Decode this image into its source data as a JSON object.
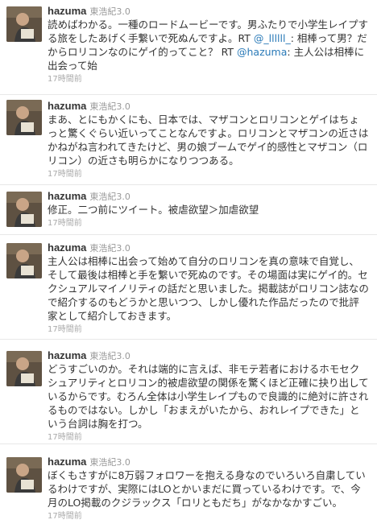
{
  "user": {
    "screen_name": "hazuma",
    "display_name": "東浩紀3.0"
  },
  "tweets": [
    {
      "parts": [
        {
          "text": "読めばわかる。一種のロードムービーです。男ふたりで小学生レイプする旅をしたあげく手繋いで死ぬんですよ。RT "
        },
        {
          "text": "@_llllll_",
          "link": true
        },
        {
          "text": ": 相棒って男？だからロリコンなのにゲイ的ってこと？ RT "
        },
        {
          "text": "@hazuma",
          "link": true
        },
        {
          "text": ": 主人公は相棒に出会って始"
        }
      ],
      "time": "17時間前"
    },
    {
      "parts": [
        {
          "text": "まあ、とにもかくにも、日本では、マザコンとロリコンとゲイはちょっと驚くぐらい近いってことなんですよ。ロリコンとマザコンの近さはかねがね言われてきたけど、男の娘ブームでゲイ的感性とマザコン（ロリコン）の近さも明らかになりつつある。"
        }
      ],
      "time": "17時間前"
    },
    {
      "parts": [
        {
          "text": "修正。二つ前にツイート。被虐欲望＞加虐欲望"
        }
      ],
      "time": "17時間前"
    },
    {
      "parts": [
        {
          "text": "主人公は相棒に出会って始めて自分のロリコンを真の意味で自覚し、そして最後は相棒と手を繋いで死ぬのです。その場面は実にゲイ的。セクシュアルマイノリティの話だと思いました。掲載誌がロリコン誌なので紹介するのもどうかと思いつつ、しかし優れた作品だったので批評家として紹介しておきます。"
        }
      ],
      "time": "17時間前"
    },
    {
      "parts": [
        {
          "text": "どうすごいのか。それは端的に言えば、非モテ若者におけるホモセクシュアリティとロリコン的被虐欲望の関係を驚くほど正確に抉り出しているからです。むろん全体は小学生レイプもので良識的に絶対に許されるものではない。しかし「おまえがいたから、おれレイプできた」という台詞は胸を打つ。"
        }
      ],
      "time": "17時間前"
    },
    {
      "parts": [
        {
          "text": "ぼくもさすがに8万弱フォロワーを抱える身なのでいろいろ自粛しているわけですが、実際にはLOとかいまだに買っているわけです。で、今月のLO掲載のクジラックス「ロリともだち」がなかなかすごい。"
        }
      ],
      "time": "17時間前"
    }
  ]
}
